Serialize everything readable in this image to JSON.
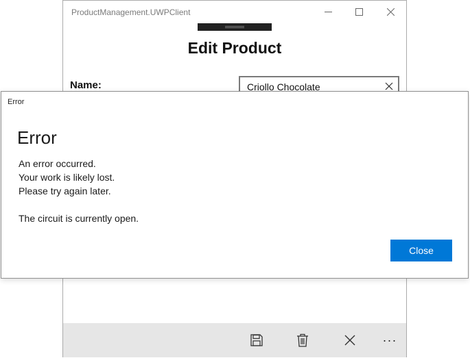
{
  "app": {
    "title": "ProductManagement.UWPClient"
  },
  "page": {
    "title": "Edit Product",
    "name_label": "Name:",
    "name_value": "Criollo Chocolate"
  },
  "command_bar": {
    "icons": [
      "save-icon",
      "delete-icon",
      "cancel-icon",
      "more-icon"
    ],
    "more_glyph": "···"
  },
  "dialog": {
    "window_title": "Error",
    "heading": "Error",
    "lines": [
      "An error occurred.",
      "Your work is likely lost.",
      "Please try again later.",
      "The circuit is currently open."
    ],
    "close_label": "Close"
  },
  "colors": {
    "accent": "#0078d7",
    "command_bar_bg": "#e6e6e6"
  }
}
